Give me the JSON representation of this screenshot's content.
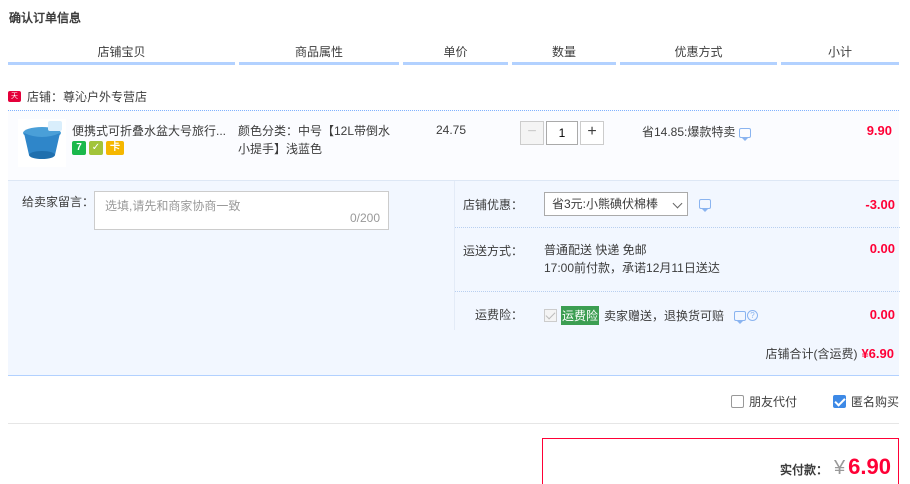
{
  "page_title": "确认订单信息",
  "columns": [
    "店铺宝贝",
    "商品属性",
    "单价",
    "数量",
    "优惠方式",
    "小计"
  ],
  "shop": {
    "badge": "天猫",
    "label": "店铺：尊沁户外专营店"
  },
  "item": {
    "title": "便携式可折叠水盆大号旅行...",
    "badges": [
      "7",
      "✓",
      "卡"
    ],
    "attr_line1": "颜色分类：中号【12L带倒水",
    "attr_line2": "小提手】浅蓝色",
    "unit_price": "24.75",
    "qty": "1",
    "minus": "−",
    "plus": "+",
    "discount": "省14.85:爆款特卖",
    "subtotal": "9.90"
  },
  "memo": {
    "label": "给卖家留言：",
    "placeholder": "选填,请先和商家协商一致",
    "count": "0/200"
  },
  "shop_discount": {
    "label": "店铺优惠：",
    "selected": "省3元:小熊碘伏棉棒",
    "value": "-3.00"
  },
  "shipping": {
    "label": "运送方式：",
    "line1": "普通配送 快递 免邮",
    "line2": "17:00前付款，承诺12月11日送达",
    "value": "0.00"
  },
  "insurance": {
    "label": "运费险：",
    "tag": "运费险",
    "text": "卖家赠送，退换货可赔",
    "value": "0.00"
  },
  "shop_total": {
    "label": "店铺合计(含运费)",
    "value": "¥6.90"
  },
  "friend_pay": "朋友代付",
  "anonymous": "匿名购买",
  "payment": {
    "label": "实付款：",
    "yen": "¥",
    "amount": "6.90"
  },
  "colors": {
    "accent": "#ff0036",
    "header_line": "#b2d1ff",
    "panel_bg": "#f2f7ff",
    "checkbox": "#3d89e6"
  }
}
